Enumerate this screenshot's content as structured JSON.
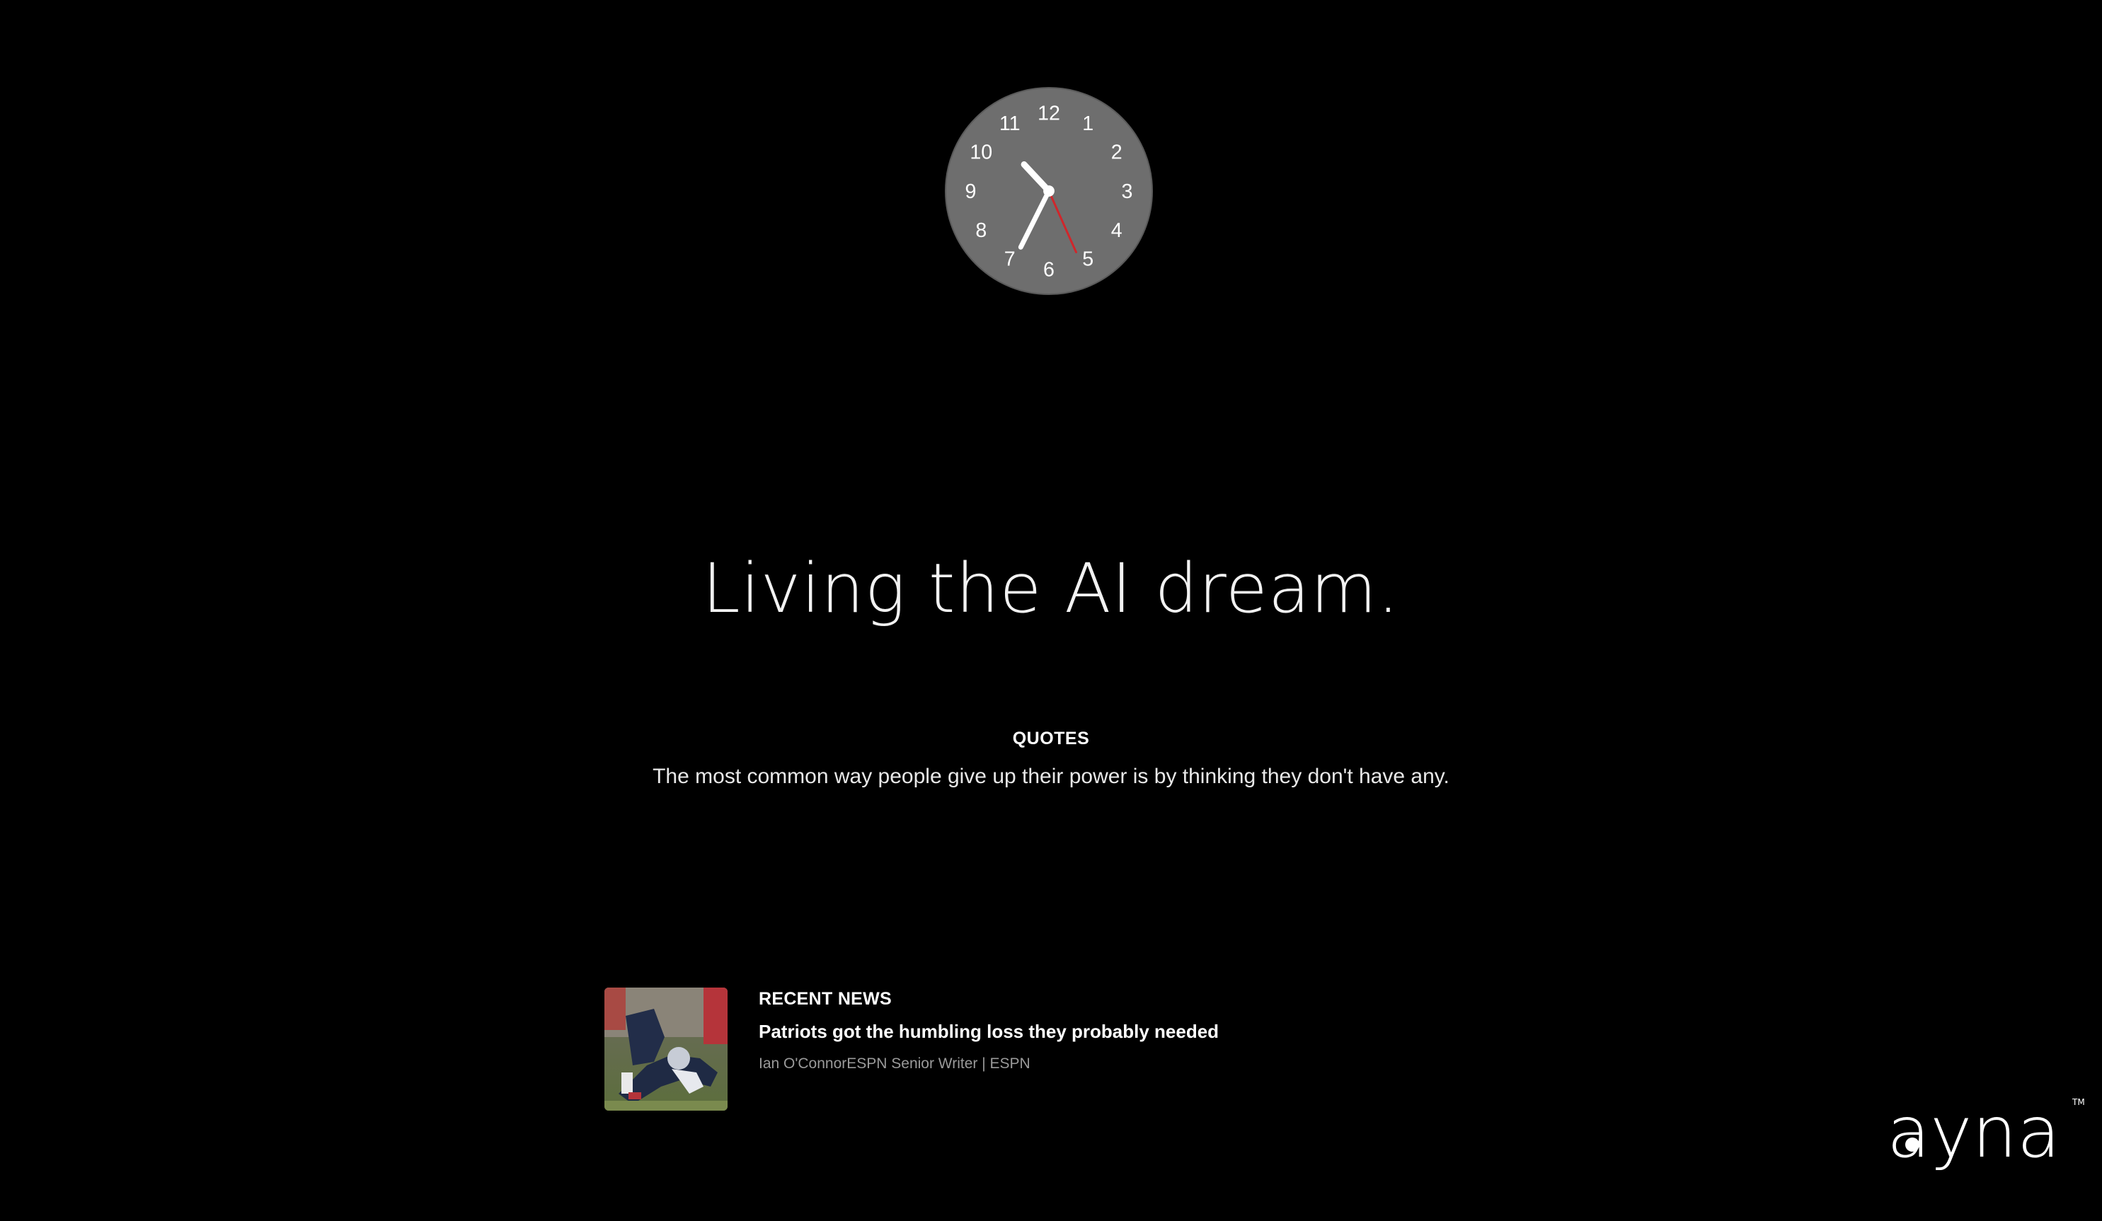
{
  "clock": {
    "numerals": [
      "12",
      "1",
      "2",
      "3",
      "4",
      "5",
      "6",
      "7",
      "8",
      "9",
      "10",
      "11"
    ],
    "face_color": "#6e6e6e",
    "hand_color": "#ffffff",
    "second_hand_color": "#d0262b",
    "time": {
      "hour": 10,
      "minute": 34,
      "second": 26
    }
  },
  "headline": "Living the AI dream.",
  "quotes": {
    "heading": "QUOTES",
    "text": "The most common way people give up their power is by thinking they don't have any."
  },
  "news": {
    "label": "RECENT NEWS",
    "title": "Patriots got the humbling loss they probably needed",
    "byline": "Ian O'ConnorESPN Senior Writer | ESPN"
  },
  "logo": {
    "text": "ayna",
    "mark": "TM"
  }
}
